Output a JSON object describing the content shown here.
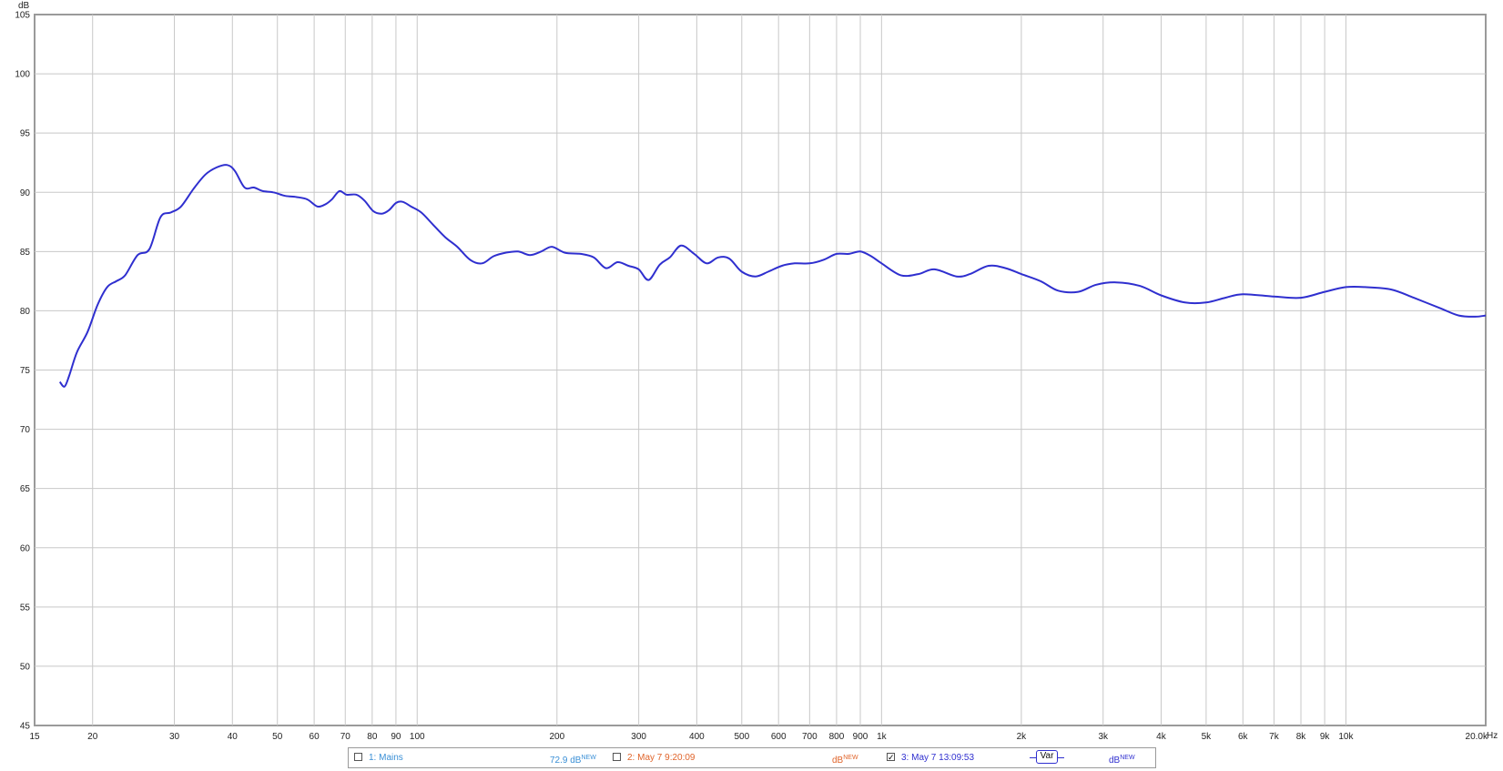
{
  "chart_data": {
    "type": "line",
    "title": "",
    "ylabel": "dB",
    "xlabel": "Hz",
    "x_scale": "log",
    "xlim": [
      15,
      20000
    ],
    "ylim": [
      45,
      105
    ],
    "grid": true,
    "y_ticks": [
      "105",
      "100",
      "95",
      "90",
      "85",
      "80",
      "75",
      "70",
      "65",
      "60",
      "55",
      "50",
      "45"
    ],
    "x_tick_values": [
      15,
      20,
      30,
      40,
      50,
      60,
      70,
      80,
      90,
      100,
      200,
      300,
      400,
      500,
      600,
      700,
      800,
      900,
      1000,
      2000,
      3000,
      4000,
      5000,
      6000,
      7000,
      8000,
      9000,
      10000,
      20000
    ],
    "x_ticks": [
      "15",
      "20",
      "30",
      "40",
      "50",
      "60",
      "70",
      "80",
      "90",
      "100",
      "200",
      "300",
      "400",
      "500",
      "600",
      "700",
      "800",
      "900",
      "1k",
      "2k",
      "3k",
      "4k",
      "5k",
      "6k",
      "7k",
      "8k",
      "9k",
      "10k",
      "20.0k"
    ],
    "series": [
      {
        "name": "3: May 7 13:09:53",
        "color": "#2f2fcf",
        "points": [
          [
            17.0,
            74.0
          ],
          [
            17.4,
            73.6
          ],
          [
            17.8,
            74.5
          ],
          [
            18.5,
            76.5
          ],
          [
            19.5,
            78.2
          ],
          [
            20.5,
            80.5
          ],
          [
            21.5,
            82.0
          ],
          [
            22.5,
            82.5
          ],
          [
            23.5,
            83.0
          ],
          [
            25.0,
            84.7
          ],
          [
            26.5,
            85.2
          ],
          [
            28.0,
            87.9
          ],
          [
            29.5,
            88.3
          ],
          [
            31.0,
            88.8
          ],
          [
            33.0,
            90.3
          ],
          [
            35.0,
            91.5
          ],
          [
            37.0,
            92.1
          ],
          [
            39.0,
            92.3
          ],
          [
            40.5,
            91.8
          ],
          [
            42.5,
            90.4
          ],
          [
            44.5,
            90.4
          ],
          [
            46.5,
            90.1
          ],
          [
            49.0,
            90.0
          ],
          [
            52.0,
            89.7
          ],
          [
            55.0,
            89.6
          ],
          [
            58.0,
            89.4
          ],
          [
            61.0,
            88.8
          ],
          [
            63.5,
            89.0
          ],
          [
            65.5,
            89.4
          ],
          [
            68.0,
            90.1
          ],
          [
            70.5,
            89.8
          ],
          [
            74.0,
            89.8
          ],
          [
            77.0,
            89.3
          ],
          [
            80.5,
            88.4
          ],
          [
            84.0,
            88.2
          ],
          [
            87.0,
            88.5
          ],
          [
            90.0,
            89.1
          ],
          [
            93.0,
            89.2
          ],
          [
            97.0,
            88.8
          ],
          [
            102.0,
            88.3
          ],
          [
            108.0,
            87.3
          ],
          [
            115.0,
            86.2
          ],
          [
            122.0,
            85.4
          ],
          [
            130.0,
            84.3
          ],
          [
            138.0,
            84.0
          ],
          [
            146.0,
            84.6
          ],
          [
            155.0,
            84.9
          ],
          [
            165.0,
            85.0
          ],
          [
            175.0,
            84.7
          ],
          [
            185.0,
            85.0
          ],
          [
            195.0,
            85.4
          ],
          [
            208.0,
            84.9
          ],
          [
            225.0,
            84.8
          ],
          [
            240.0,
            84.5
          ],
          [
            255.0,
            83.6
          ],
          [
            270.0,
            84.1
          ],
          [
            285.0,
            83.8
          ],
          [
            300.0,
            83.5
          ],
          [
            315.0,
            82.6
          ],
          [
            333.0,
            83.9
          ],
          [
            350.0,
            84.5
          ],
          [
            370.0,
            85.5
          ],
          [
            395.0,
            84.8
          ],
          [
            420.0,
            84.0
          ],
          [
            445.0,
            84.5
          ],
          [
            470.0,
            84.4
          ],
          [
            500.0,
            83.3
          ],
          [
            535.0,
            82.9
          ],
          [
            570.0,
            83.3
          ],
          [
            610.0,
            83.8
          ],
          [
            650.0,
            84.0
          ],
          [
            700.0,
            84.0
          ],
          [
            750.0,
            84.3
          ],
          [
            800.0,
            84.8
          ],
          [
            850.0,
            84.8
          ],
          [
            900.0,
            85.0
          ],
          [
            950.0,
            84.6
          ],
          [
            1000.0,
            84.0
          ],
          [
            1100.0,
            83.0
          ],
          [
            1200.0,
            83.1
          ],
          [
            1300.0,
            83.5
          ],
          [
            1450.0,
            82.9
          ],
          [
            1550.0,
            83.1
          ],
          [
            1700.0,
            83.8
          ],
          [
            1850.0,
            83.6
          ],
          [
            2000.0,
            83.1
          ],
          [
            2200.0,
            82.5
          ],
          [
            2400.0,
            81.7
          ],
          [
            2650.0,
            81.6
          ],
          [
            2900.0,
            82.2
          ],
          [
            3200.0,
            82.4
          ],
          [
            3600.0,
            82.1
          ],
          [
            4000.0,
            81.3
          ],
          [
            4500.0,
            80.7
          ],
          [
            5000.0,
            80.7
          ],
          [
            5500.0,
            81.1
          ],
          [
            6000.0,
            81.4
          ],
          [
            7000.0,
            81.2
          ],
          [
            8000.0,
            81.1
          ],
          [
            9000.0,
            81.6
          ],
          [
            10000.0,
            82.0
          ],
          [
            11000.0,
            82.0
          ],
          [
            12500.0,
            81.8
          ],
          [
            14000.0,
            81.1
          ],
          [
            16000.0,
            80.2
          ],
          [
            17500.0,
            79.6
          ],
          [
            19000.0,
            79.5
          ],
          [
            20000.0,
            79.6
          ]
        ]
      }
    ]
  },
  "legend": {
    "items": [
      {
        "label": "1: Mains",
        "value": "72.9 dB",
        "value_sup": "NEW",
        "color": "#3a8fd6",
        "checked": false
      },
      {
        "label": "2: May 7 9:20:09",
        "value": "dB",
        "value_sup": "NEW",
        "color": "#e0642a",
        "checked": false
      },
      {
        "label": "3: May 7 13:09:53",
        "value": "dB",
        "value_sup": "NEW",
        "color": "#2f2fcf",
        "checked": true,
        "button": "Var"
      }
    ]
  }
}
